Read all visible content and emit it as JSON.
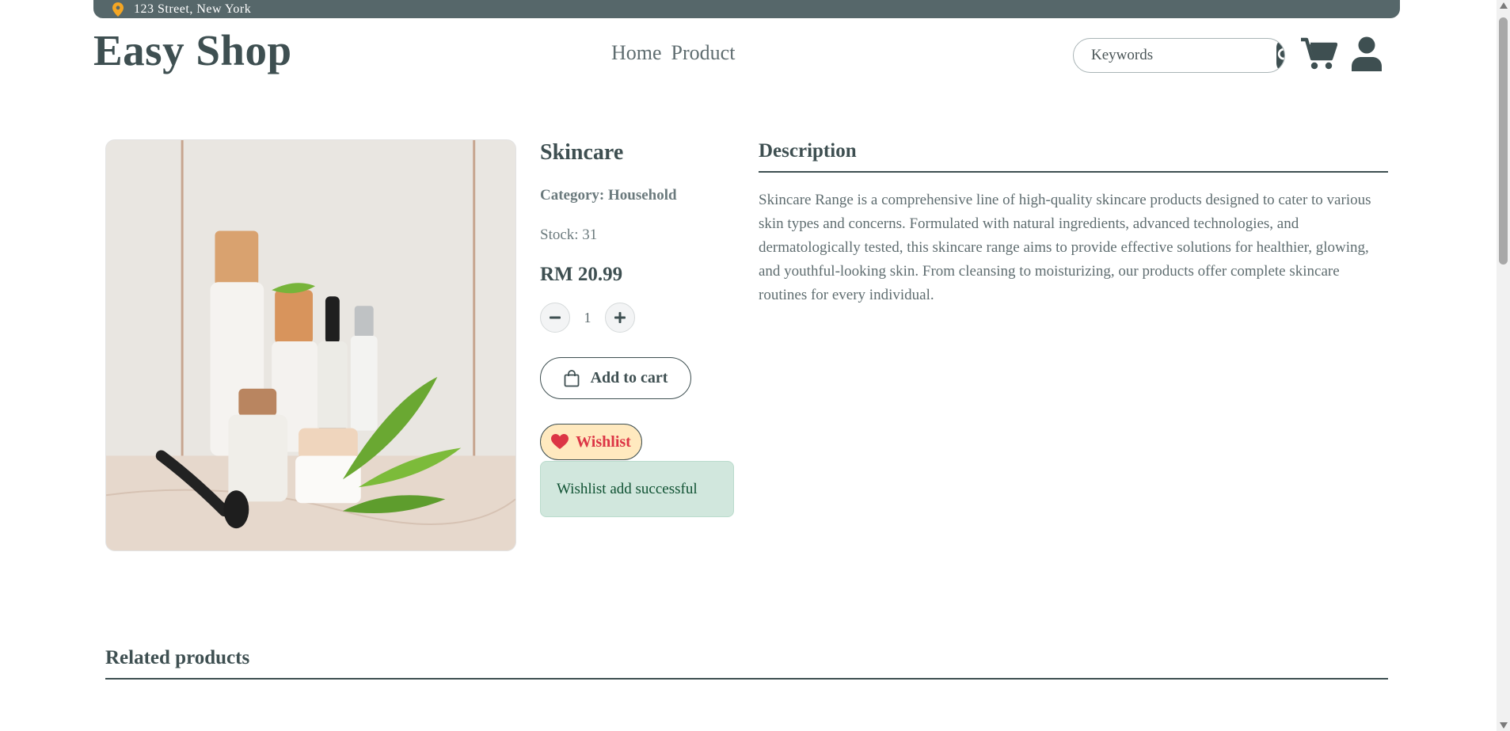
{
  "topbar": {
    "address": "123 Street, New York",
    "icon": "location-pin-icon"
  },
  "header": {
    "logo": "Easy Shop",
    "nav": [
      {
        "label": "Home"
      },
      {
        "label": "Product"
      }
    ],
    "search": {
      "placeholder": "Keywords",
      "value": ""
    },
    "icons": [
      "search-icon",
      "cart-icon",
      "user-icon"
    ]
  },
  "product": {
    "title": "Skincare",
    "category": "Category: Household",
    "stock": "Stock: 31",
    "price": "RM 20.99",
    "quantity": "1",
    "add_to_cart_label": "Add to cart",
    "wishlist_label": "Wishlist",
    "alert": "Wishlist add successful"
  },
  "description": {
    "heading": "Description",
    "text": "Skincare Range is a comprehensive line of high-quality skincare products designed to cater to various skin types and concerns. Formulated with natural ingredients, advanced technologies, and dermatologically tested, this skincare range aims to provide effective solutions for healthier, glowing, and youthful-looking skin. From cleansing to moisturizing, our products offer complete skincare routines for every individual."
  },
  "related": {
    "heading": "Related products"
  },
  "colors": {
    "primary": "#3e4f51",
    "topbar": "#56676a",
    "wishlist_bg": "#ffe9bf",
    "wishlist_text": "#dc3545",
    "alert_bg": "#d1e7dd",
    "alert_text": "#0f5132",
    "pin": "#f5a623"
  }
}
